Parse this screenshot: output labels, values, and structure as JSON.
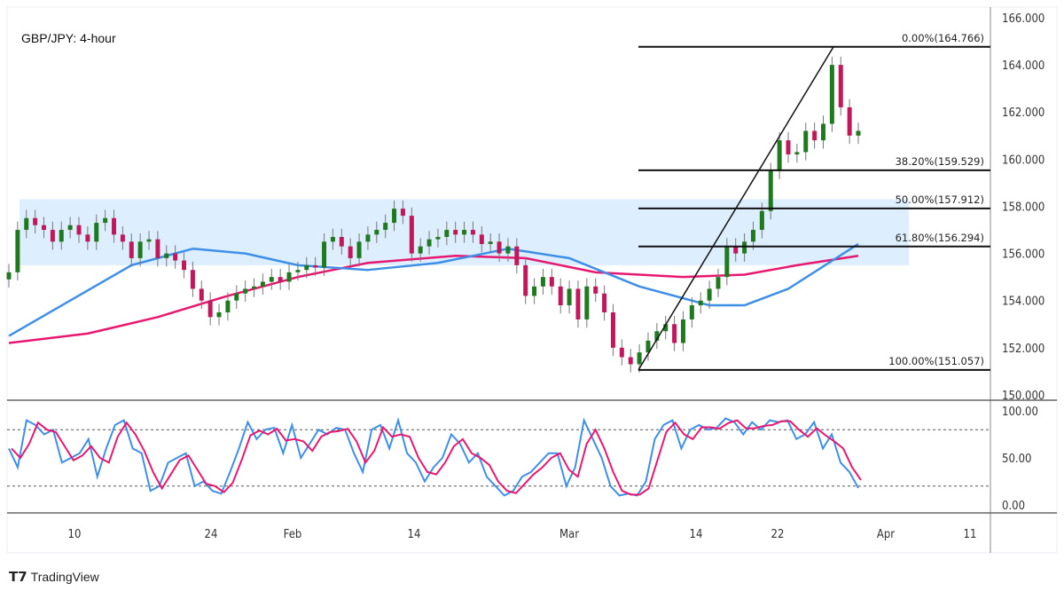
{
  "chart_data": {
    "type": "candlestick",
    "title": "GBP/JPY: 4-hour",
    "price_axis": {
      "ticks": [
        "166.000",
        "164.000",
        "162.000",
        "160.000",
        "158.000",
        "156.000",
        "154.000",
        "152.000",
        "150.000"
      ],
      "ylim": [
        150,
        166
      ]
    },
    "time_axis": {
      "ticks": [
        "10",
        "24",
        "Feb",
        "14",
        "Mar",
        "14",
        "22",
        "Apr",
        "11"
      ]
    },
    "closes": [
      155.2,
      157.0,
      157.5,
      157.2,
      157.0,
      156.5,
      157.0,
      157.2,
      156.8,
      156.5,
      157.3,
      157.5,
      156.8,
      156.5,
      155.8,
      156.5,
      156.6,
      155.8,
      156.0,
      155.7,
      155.3,
      154.5,
      154.0,
      153.3,
      153.5,
      154.0,
      154.3,
      154.5,
      154.6,
      154.8,
      155.0,
      154.8,
      155.2,
      155.3,
      155.5,
      155.4,
      156.5,
      156.7,
      156.3,
      155.8,
      156.5,
      156.8,
      157.0,
      157.3,
      157.9,
      157.6,
      156.0,
      156.3,
      156.6,
      156.7,
      157.0,
      156.8,
      157.0,
      156.8,
      156.4,
      156.5,
      156.0,
      156.3,
      155.5,
      154.2,
      154.6,
      155.0,
      154.6,
      153.8,
      154.5,
      153.2,
      154.6,
      154.3,
      153.5,
      152.0,
      151.6,
      151.3,
      151.8,
      152.3,
      152.7,
      153.0,
      152.2,
      153.2,
      153.8,
      154.0,
      154.5,
      155.0,
      156.3,
      156.0,
      156.5,
      157.0,
      157.8,
      159.5,
      160.8,
      160.2,
      160.3,
      161.2,
      160.8,
      161.5,
      164.0,
      162.2,
      161.0,
      161.2
    ],
    "ma_blue": [
      [
        0,
        152.5
      ],
      [
        7,
        154.0
      ],
      [
        14,
        155.5
      ],
      [
        21,
        156.2
      ],
      [
        27,
        156.0
      ],
      [
        33,
        155.5
      ],
      [
        41,
        155.3
      ],
      [
        49,
        155.6
      ],
      [
        57,
        156.2
      ],
      [
        64,
        155.8
      ],
      [
        72,
        154.6
      ],
      [
        80,
        153.8
      ],
      [
        84,
        153.8
      ],
      [
        89,
        154.5
      ],
      [
        97,
        156.4
      ]
    ],
    "ma_red": [
      [
        0,
        152.2
      ],
      [
        9,
        152.6
      ],
      [
        17,
        153.3
      ],
      [
        25,
        154.2
      ],
      [
        33,
        155.0
      ],
      [
        41,
        155.6
      ],
      [
        51,
        155.9
      ],
      [
        59,
        155.8
      ],
      [
        67,
        155.2
      ],
      [
        77,
        155.0
      ],
      [
        84,
        155.1
      ],
      [
        90,
        155.5
      ],
      [
        97,
        155.9
      ]
    ],
    "support_zone": [
      155.5,
      158.3
    ],
    "fibonacci": {
      "from": 151.057,
      "to": 164.766,
      "levels": [
        {
          "label": "0.00%(164.766)",
          "price": 164.766
        },
        {
          "label": "38.20%(159.529)",
          "price": 159.529
        },
        {
          "label": "50.00%(157.912)",
          "price": 157.912
        },
        {
          "label": "61.80%(156.294)",
          "price": 156.294
        },
        {
          "label": "100.00%(151.057)",
          "price": 151.057
        }
      ]
    },
    "stochastic": {
      "ticks": [
        "100.00",
        "50.00",
        "0.00"
      ],
      "levels": [
        80,
        20
      ],
      "k": [
        60,
        40,
        90,
        85,
        75,
        80,
        45,
        50,
        55,
        70,
        30,
        60,
        85,
        90,
        60,
        55,
        15,
        20,
        45,
        50,
        55,
        20,
        25,
        15,
        12,
        35,
        60,
        88,
        70,
        80,
        82,
        55,
        85,
        50,
        65,
        80,
        75,
        82,
        80,
        55,
        35,
        80,
        85,
        60,
        90,
        55,
        45,
        25,
        40,
        50,
        75,
        65,
        45,
        55,
        30,
        20,
        10,
        15,
        30,
        35,
        45,
        55,
        55,
        20,
        40,
        90,
        70,
        50,
        20,
        10,
        12,
        10,
        25,
        70,
        85,
        90,
        60,
        80,
        85,
        80,
        82,
        92,
        88,
        75,
        88,
        80,
        90,
        88,
        90,
        70,
        75,
        88,
        60,
        75,
        45,
        35,
        18
      ]
    },
    "colors": {
      "up": "#1f7a1f",
      "down": "#c2185b",
      "ma_blue": "#3d8fe8",
      "ma_red": "#e8176f",
      "zone": "#ddeeff",
      "k": "#3d8fe8",
      "d": "#e8176f"
    }
  },
  "branding": {
    "logo_text": "TradingView"
  }
}
